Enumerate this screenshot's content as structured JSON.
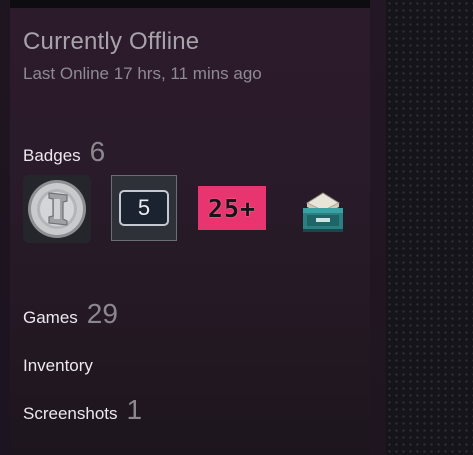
{
  "profile": {
    "status": "Currently Offline",
    "last_online": "Last Online 17 hrs, 11 mins ago"
  },
  "badges": {
    "label": "Badges",
    "count": "6",
    "items": [
      {
        "name": "coin-badge-icon"
      },
      {
        "name": "level-badge-icon",
        "text": "5"
      },
      {
        "name": "years-badge-icon",
        "text": "25+"
      },
      {
        "name": "mailbox-badge-icon"
      }
    ]
  },
  "games": {
    "label": "Games",
    "count": "29"
  },
  "inventory": {
    "label": "Inventory"
  },
  "screenshots": {
    "label": "Screenshots",
    "count": "1"
  },
  "colors": {
    "panel": "#2a1b2a",
    "accent_badge": "#e8356f"
  }
}
